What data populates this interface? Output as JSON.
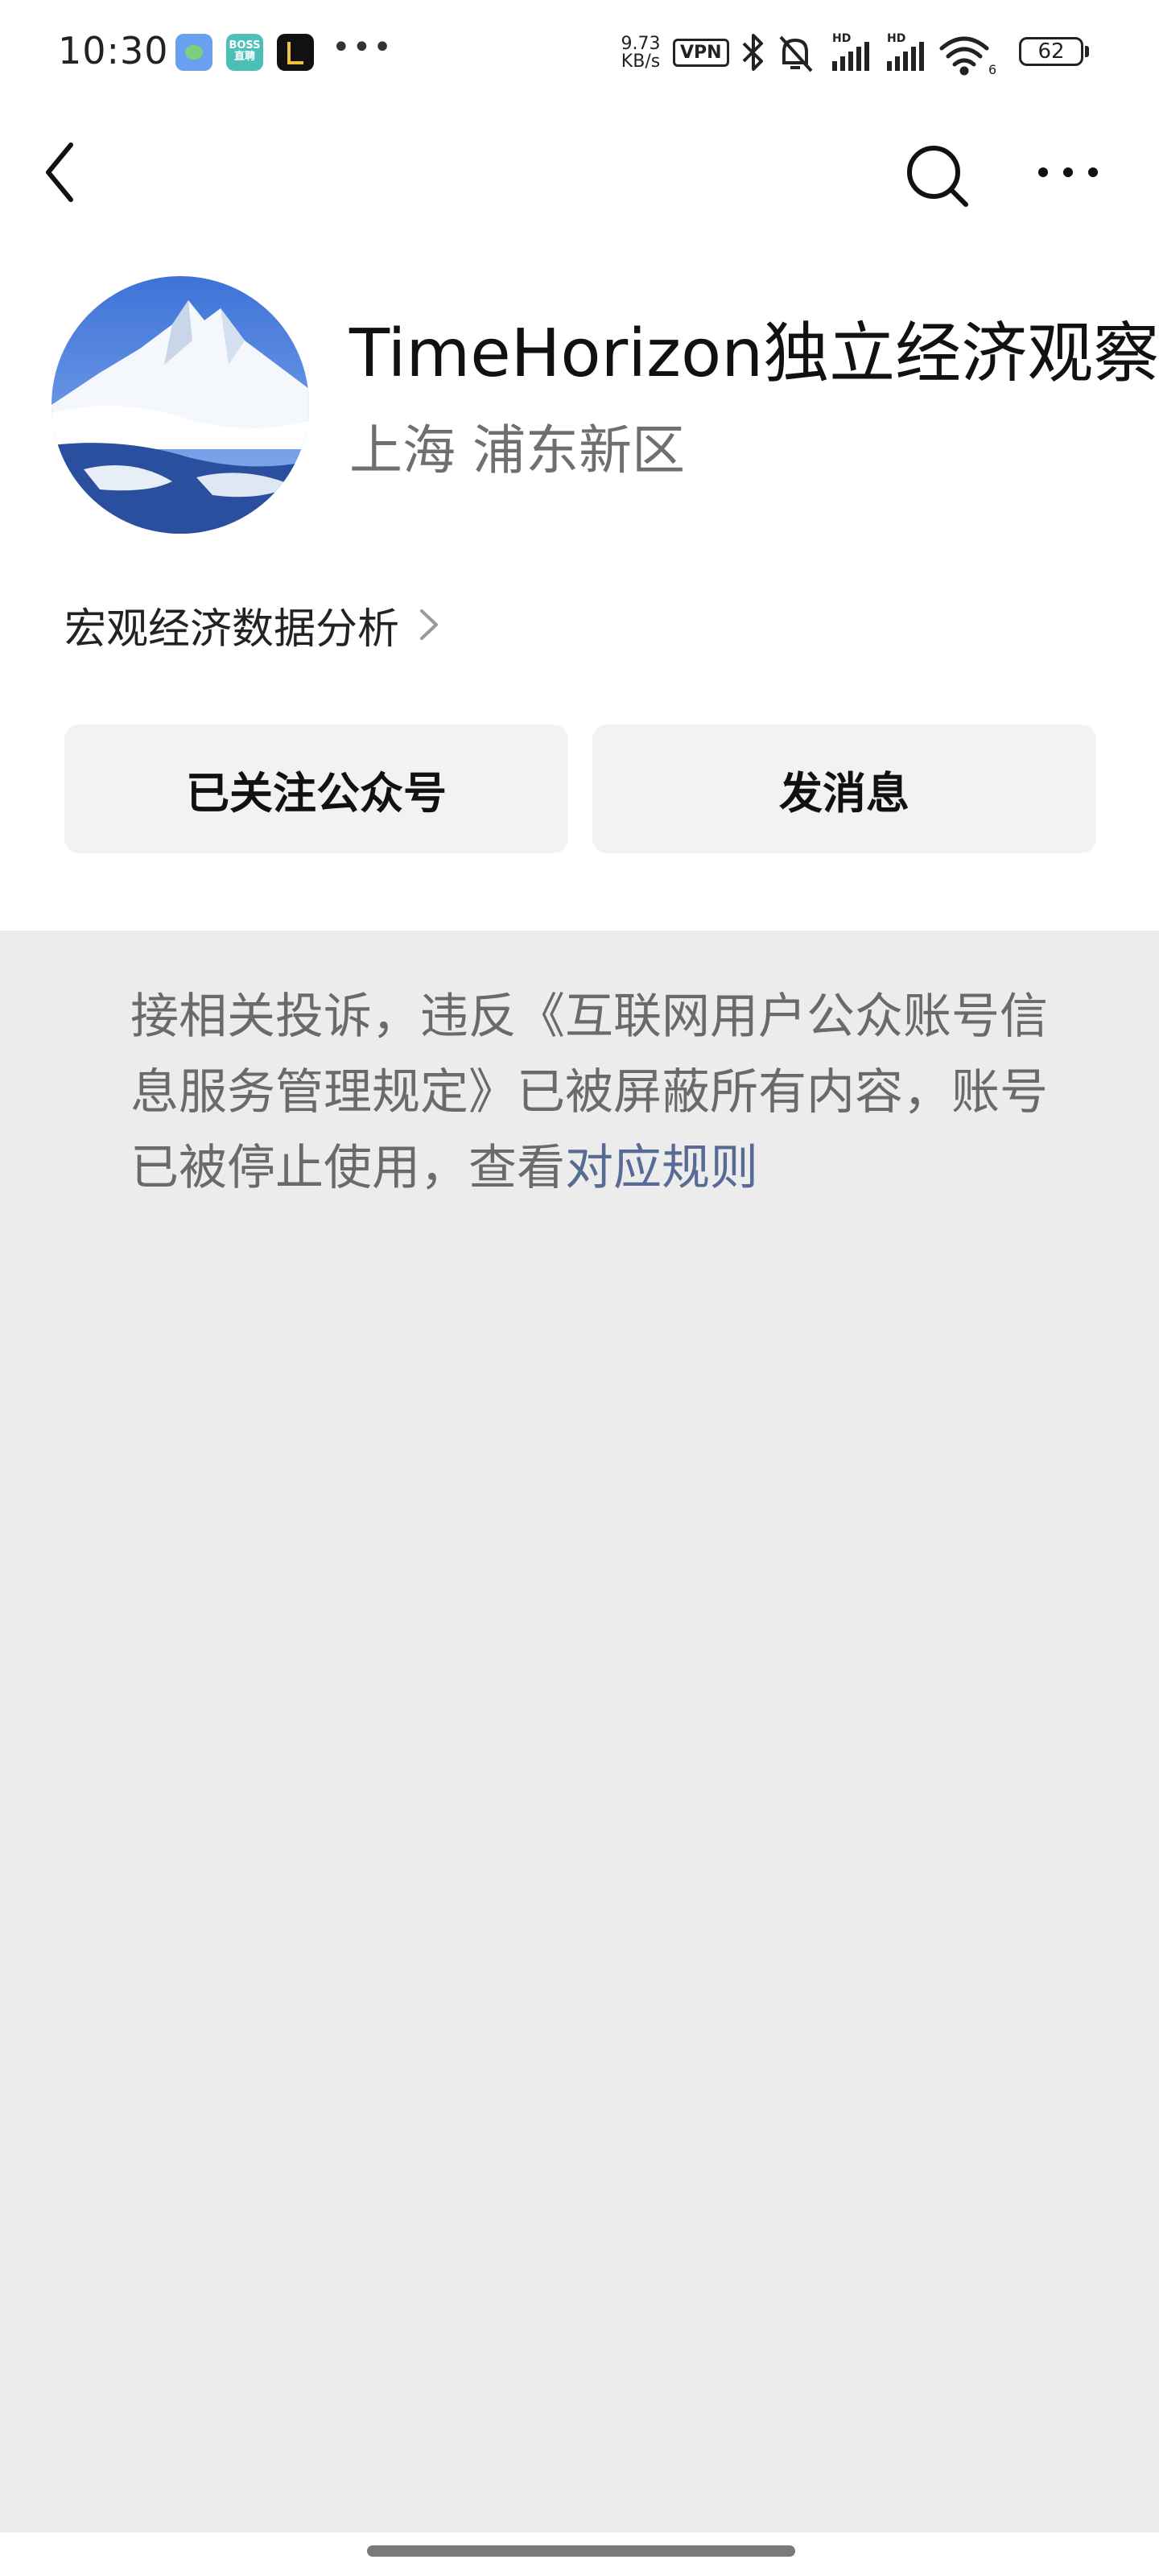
{
  "status_bar": {
    "time": "10:30",
    "app_badge_2": "BOSS 直聘",
    "network_speed": "9.73 KB/s",
    "vpn": "VPN",
    "battery": "62",
    "icons": [
      "app-icon-1",
      "boss-zhipin-icon",
      "app-icon-3",
      "more-dots-icon",
      "bluetooth-icon",
      "mute-icon",
      "signal-hd-icon",
      "signal-hd-icon",
      "wifi-icon",
      "battery-icon"
    ]
  },
  "nav": {
    "icons": [
      "back-icon",
      "search-icon",
      "more-icon"
    ]
  },
  "profile": {
    "name": "TimeHorizon独立经济观察",
    "location": "上海 浦东新区",
    "intro": "宏观经济数据分析",
    "avatar": "snow-mountain-avatar"
  },
  "buttons": {
    "follow": "已关注公众号",
    "message": "发消息"
  },
  "notice": {
    "text": "接相关投诉，违反《互联网用户公众账号信息服务管理规定》已被屏蔽所有内容，账号已被停止使用，查看",
    "link": "对应规则"
  },
  "colors": {
    "link": "#576b95",
    "content_bg": "#ececec",
    "button_bg": "#f2f2f2"
  }
}
